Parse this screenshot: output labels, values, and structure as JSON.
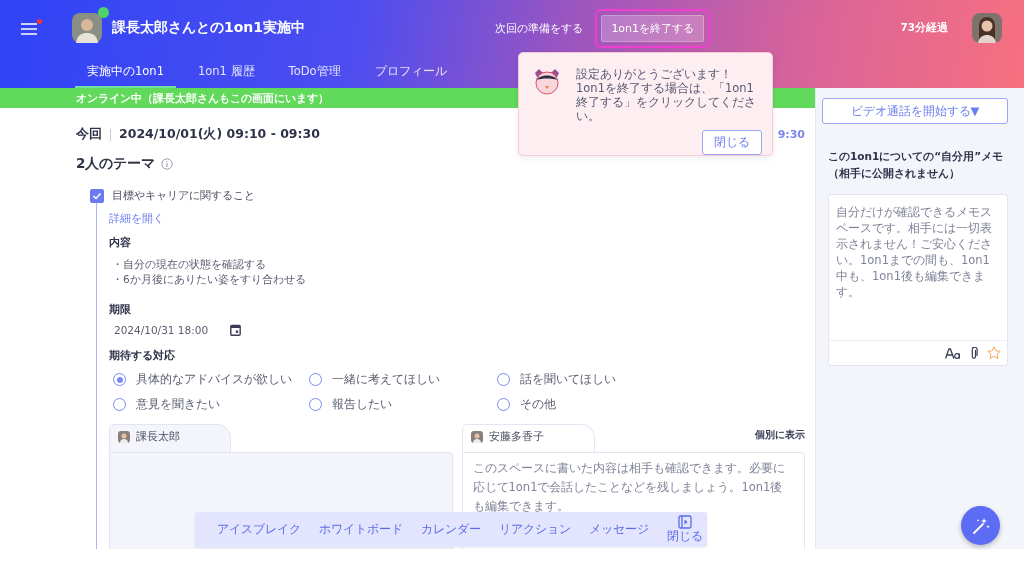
{
  "header": {
    "menu_badge": true,
    "online": true,
    "title": "課長太郎さんとの1on1実施中",
    "prepare_link": "次回の準備をする",
    "end_button": {
      "label": "1on1を終了する",
      "highlighted": true
    },
    "elapsed": "73分経過"
  },
  "tabs": [
    {
      "label": "実施中の1on1",
      "selected": true
    },
    {
      "label": "1on1 履歴",
      "selected": false
    },
    {
      "label": "ToDo管理",
      "selected": false
    },
    {
      "label": "プロフィール",
      "selected": false
    }
  ],
  "status_banner": "オンライン中（課長太郎さんもこの画面にいます）",
  "session": {
    "label": "今回",
    "date": "2024/10/01(火)  09:10 - 09:30",
    "covered_time": "9:30"
  },
  "theme_heading": "2人のテーマ",
  "theme": {
    "title": "目標やキャリアに関すること",
    "checked": true,
    "details_link": "詳細を開く",
    "content_label": "内容",
    "content_items": [
      "・自分の現在の状態を確認する",
      "・6か月後にありたい姿をすり合わせる"
    ],
    "deadline_label": "期限",
    "deadline": "2024/10/31 18:00",
    "response_label": "期待する対応",
    "responses": [
      {
        "label": "具体的なアドバイスが欲しい",
        "selected": true
      },
      {
        "label": "一緒に考えてほしい",
        "selected": false
      },
      {
        "label": "話を聞いてほしい",
        "selected": false
      },
      {
        "label": "意見を聞きたい",
        "selected": false
      },
      {
        "label": "報告したい",
        "selected": false
      },
      {
        "label": "その他",
        "selected": false
      }
    ]
  },
  "shared_memos": {
    "toggle": "個別に表示",
    "memos": [
      {
        "name": "課長太郎"
      },
      {
        "name": "安藤多香子",
        "placeholder": "このスペースに書いた内容は相手も確認できます。必要に応じて1on1で会話したことなどを残しましょう。1on1後も編集できます。"
      }
    ]
  },
  "toolbar": {
    "items": [
      "アイスブレイク",
      "ホワイトボード",
      "カレンダー",
      "リアクション",
      "メッセージ"
    ],
    "close": "閉じる"
  },
  "popover": {
    "lines": [
      "設定ありがとうございます！",
      "1on1を終了する場合は、「1on1終了する」をクリックしてください。"
    ],
    "button": "閉じる"
  },
  "sidebar": {
    "video_button": "ビデオ通話を開始する▼",
    "memo_title": "この1on1についての“自分用”メモ（相手に公開されません）",
    "memo_placeholder": "自分だけが確認できるメモスペースです。相手には一切表示されません！ご安心ください。1on1までの間も、1on1中も、1on1後も編集できます。",
    "starred": false
  }
}
